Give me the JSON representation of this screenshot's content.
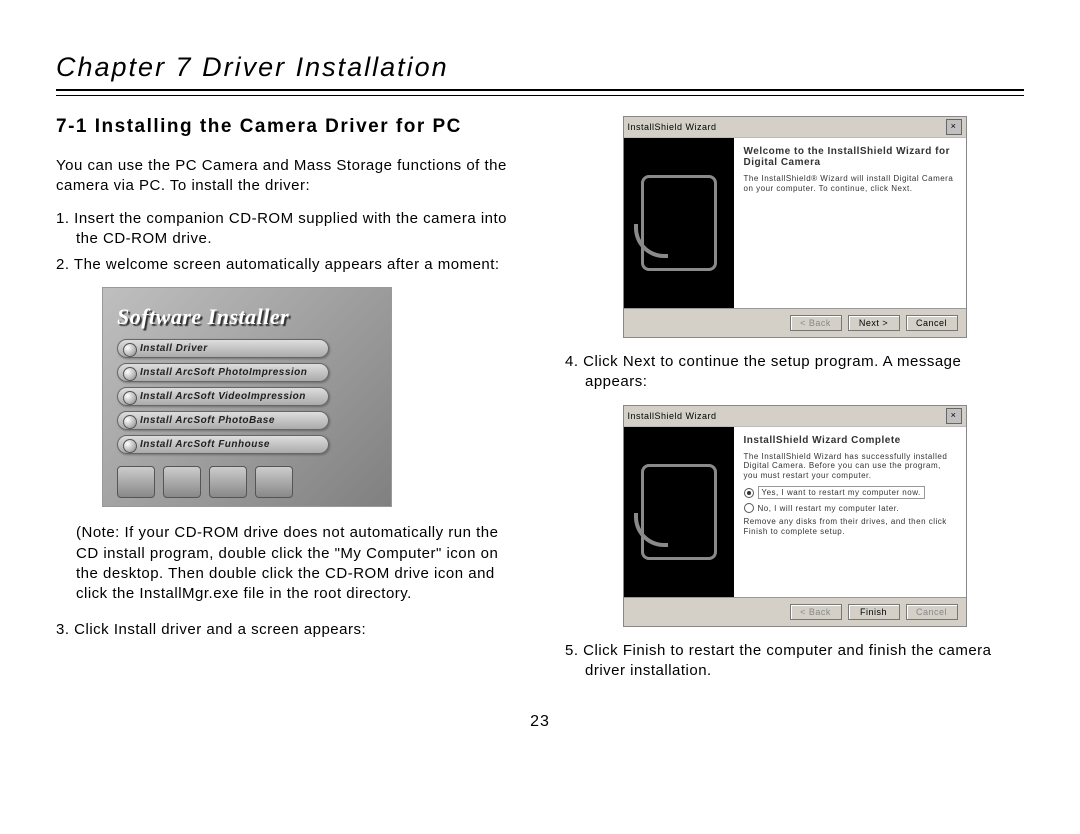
{
  "chapter_title": "Chapter 7 Driver Installation",
  "section_title": "7-1 Installing the Camera Driver for PC",
  "intro": "You can use the PC Camera and Mass Storage functions of the camera via PC. To install the driver:",
  "steps_left": {
    "s1": "1. Insert the companion CD-ROM supplied with the camera into the CD-ROM drive.",
    "s2": "2. The welcome screen automatically appears after a moment:",
    "s3": "3. Click Install driver and a screen appears:"
  },
  "note": "(Note: If your CD-ROM drive does not automatically run the CD install program, double click the \"My Computer\" icon on the desktop. Then double click the CD-ROM drive icon and click the InstallMgr.exe file in the root directory.",
  "installer": {
    "title": "Software Installer",
    "buttons": [
      "Install Driver",
      "Install ArcSoft PhotoImpression",
      "Install ArcSoft VideoImpression",
      "Install ArcSoft PhotoBase",
      "Install ArcSoft Funhouse"
    ]
  },
  "steps_right": {
    "s4": "4. Click Next to continue the setup program. A message appears:",
    "s5": "5. Click Finish to restart the computer and finish the camera driver installation."
  },
  "wizard1": {
    "titlebar": "InstallShield Wizard",
    "heading": "Welcome to the InstallShield Wizard for Digital Camera",
    "body": "The InstallShield® Wizard will install Digital Camera on your computer. To continue, click Next.",
    "back": "< Back",
    "next": "Next >",
    "cancel": "Cancel"
  },
  "wizard2": {
    "titlebar": "InstallShield Wizard",
    "heading": "InstallShield Wizard Complete",
    "body": "The InstallShield Wizard has successfully installed Digital Camera. Before you can use the program, you must restart your computer.",
    "opt1": "Yes, I want to restart my computer now.",
    "opt2": "No, I will restart my computer later.",
    "body2": "Remove any disks from their drives, and then click Finish to complete setup.",
    "back": "< Back",
    "finish": "Finish",
    "cancel": "Cancel"
  },
  "page_number": "23"
}
